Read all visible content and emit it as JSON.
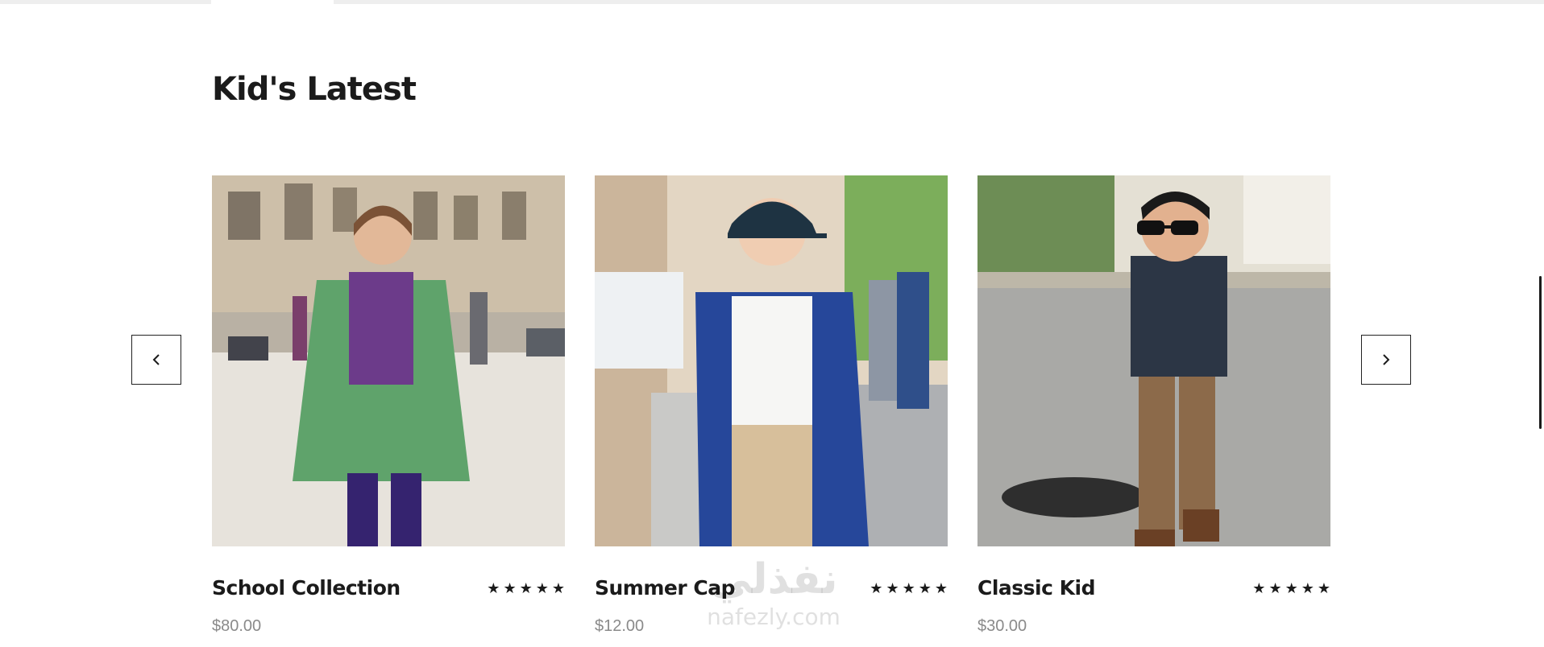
{
  "section": {
    "title": "Kid's Latest"
  },
  "carousel": {
    "prev_icon": "chevron-left-icon",
    "next_icon": "chevron-right-icon"
  },
  "products": [
    {
      "title": "School Collection",
      "price": "$80.00",
      "rating": 5
    },
    {
      "title": "Summer Cap",
      "price": "$12.00",
      "rating": 5
    },
    {
      "title": "Classic Kid",
      "price": "$30.00",
      "rating": 5
    }
  ],
  "watermark": {
    "arabic": "نفذلي",
    "latin": "nafezly.com"
  },
  "colors": {
    "text": "#1b1b1b",
    "price": "#8a8a8a",
    "border": "#222222"
  }
}
